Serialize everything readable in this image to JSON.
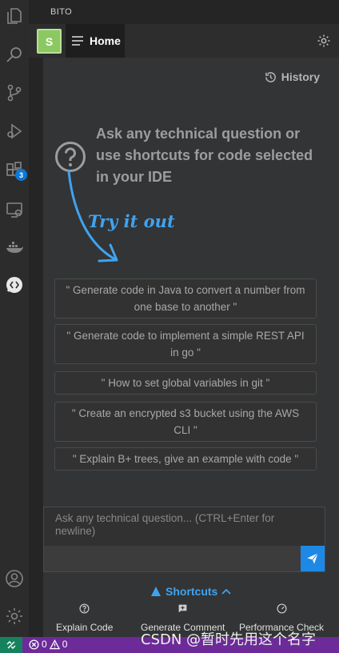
{
  "panel": {
    "title": "BITO"
  },
  "activity_bar": {
    "icons": [
      "explorer-icon",
      "search-icon",
      "source-control-icon",
      "run-debug-icon",
      "extensions-icon",
      "remote-explorer-icon",
      "docker-icon",
      "bito-icon",
      "account-icon",
      "manage-gear-icon"
    ],
    "extensions_badge": "3"
  },
  "topbar": {
    "avatar_letter": "S",
    "home_label": "Home"
  },
  "history": {
    "label": "History"
  },
  "intro": {
    "line1": "Ask any technical question or",
    "line2": "use shortcuts for code selected",
    "line3": "in your IDE"
  },
  "tryit": {
    "label": "Try it out"
  },
  "suggestions": [
    {
      "line1": "\" Generate code in Java to convert a number from",
      "line2": "one base to another \""
    },
    {
      "line1": "\" Generate code to implement a simple REST API",
      "line2": "in go \""
    },
    {
      "line1": "\" How to set global variables in git \"",
      "line2": ""
    },
    {
      "line1": "\" Create an encrypted s3 bucket using the AWS",
      "line2": "CLI \""
    },
    {
      "line1": "\" Explain B+ trees, give an example with code \"",
      "line2": ""
    }
  ],
  "input": {
    "placeholder_line1": "Ask any technical question... (CTRL+Enter for",
    "placeholder_line2": "newline)"
  },
  "shortcuts": {
    "label": "Shortcuts",
    "items": [
      {
        "label": "Explain Code",
        "icon": "question-circle-icon"
      },
      {
        "label": "Generate Comment",
        "icon": "comment-plus-icon"
      },
      {
        "label": "Performance Check",
        "icon": "gauge-icon"
      }
    ]
  },
  "statusbar": {
    "errors": "0",
    "warnings": "0"
  },
  "watermark": {
    "text": "CSDN @暂时先用这个名字"
  },
  "colors": {
    "accent": "#1e88e5",
    "statusbar": "#6c2b98",
    "remote": "#16825d",
    "avatar": "#8cc862"
  }
}
